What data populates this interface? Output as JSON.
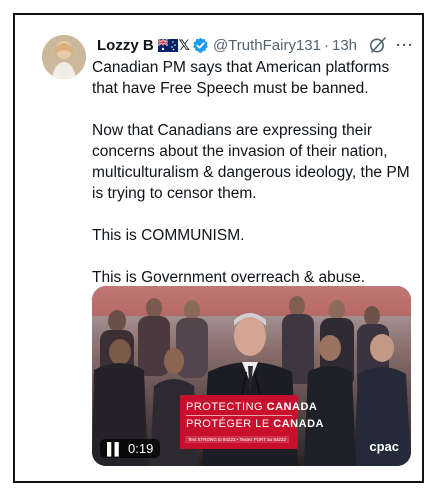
{
  "post": {
    "author_name": "Lozzy B",
    "handle": "@TruthFairy131",
    "separator": "·",
    "time": "13h",
    "more": "···",
    "paragraphs": [
      "Canadian PM says that American platforms that have Free Speech must be banned.",
      "Now that Canadians are expressing their concerns about the invasion of their nation, multiculturalism & dangerous ideology, the PM is trying to censor them.",
      "This is COMMUNISM.",
      "This is Government overreach & abuse."
    ],
    "icons": [
      "australia-flag-icon",
      "x-logo-icon",
      "verified-badge-icon",
      "grok-icon",
      "more-icon"
    ]
  },
  "video": {
    "duration": "0:19",
    "watermark": "cpac",
    "podium_line1_a": "PROTECTING ",
    "podium_line1_b": "CANADA",
    "podium_line2_a": "PROTÉGER LE ",
    "podium_line2_b": "CANADA",
    "podium_line3": "Text STRONG to 84223 • Textez FORT au 84222"
  },
  "colors": {
    "text": "#0f1419",
    "muted": "#536471",
    "verified": "#1d9bf0",
    "podium": "#c8102e"
  }
}
